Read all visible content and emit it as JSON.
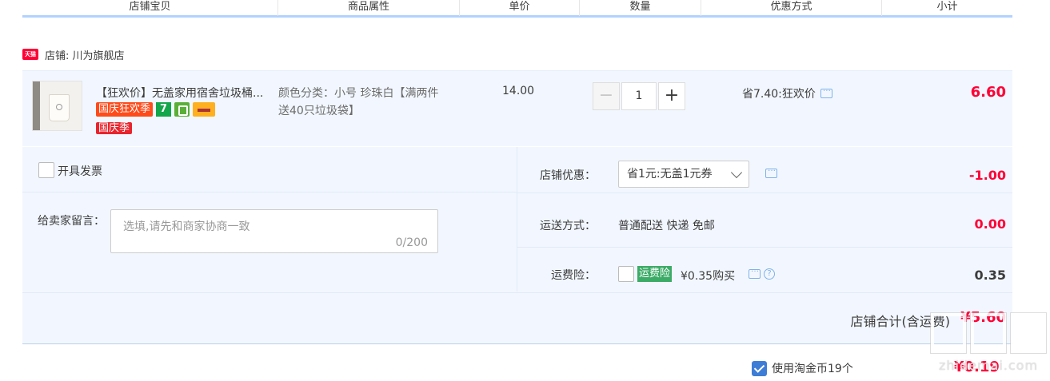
{
  "header": {
    "cols": [
      "店铺宝贝",
      "商品属性",
      "单价",
      "数量",
      "优惠方式",
      "小计"
    ]
  },
  "shop": {
    "badge": "天猫",
    "label": "店铺: 川为旗舰店"
  },
  "item": {
    "title": "【狂欢价】无盖家用宿舍垃圾桶...",
    "tags": [
      "国庆狂欢季",
      "7"
    ],
    "tag2": "国庆季",
    "attribute_line1": "颜色分类：小号 珍珠白【满两件",
    "attribute_line2": "送40只垃圾袋】",
    "price": "14.00",
    "quantity": "1",
    "discount": "省7.40:狂欢价",
    "subtotal": "6.60"
  },
  "order": {
    "invoice_label": "开具发票",
    "message_label": "给卖家留言：",
    "message_placeholder": "选填,请先和商家协商一致",
    "message_count": "0/200",
    "shop_discount_label": "店铺优惠：",
    "shop_discount_select": "省1元:无盖1元券",
    "shop_discount_value": "-1.00",
    "shipping_label": "运送方式：",
    "shipping_method": "普通配送 快递 免邮",
    "shipping_value": "0.00",
    "insurance_label": "运费险：",
    "insurance_badge": "运费险",
    "insurance_text": "¥0.35购买",
    "insurance_value": "0.35",
    "total_label": "店铺合计(含运费)",
    "total_value": "¥5.60"
  },
  "coins": {
    "label": "使用淘金币19个",
    "value": "¥0.19"
  },
  "watermark": {
    "text": "zhidemai.com"
  },
  "colors": {
    "accent_red": "#ff0036",
    "header_line": "#b2d1ff",
    "panel_bg": "#f2f7ff",
    "insurance_green": "#3cab67"
  }
}
